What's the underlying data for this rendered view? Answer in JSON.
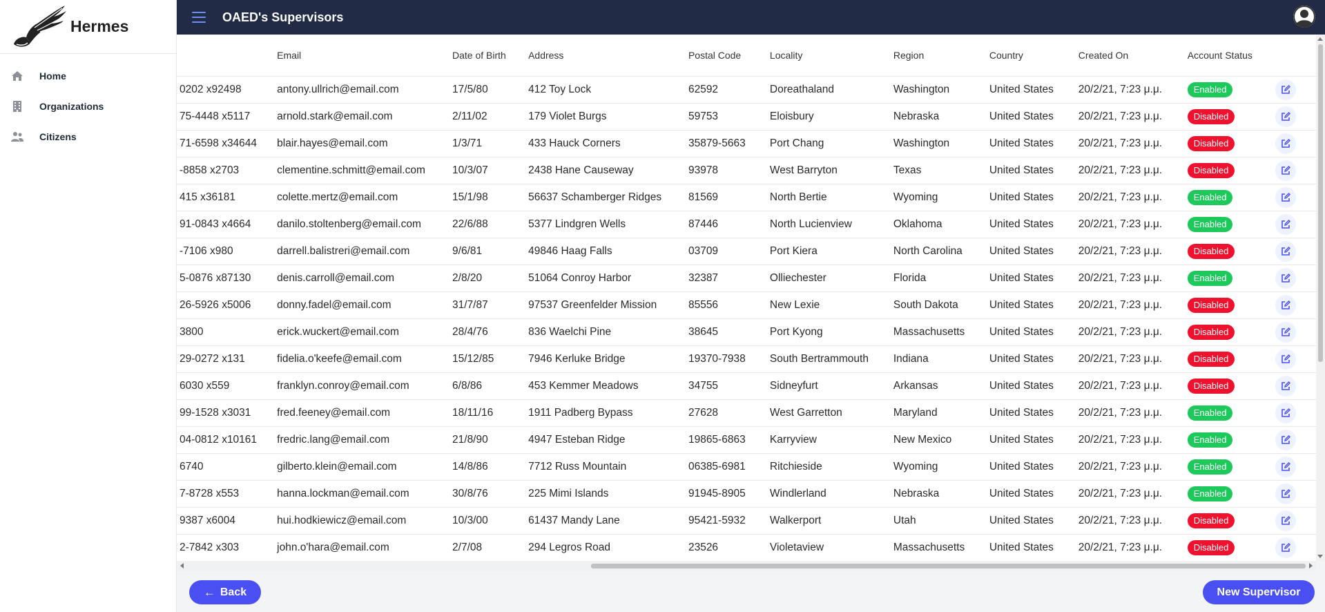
{
  "brand": {
    "name": "Hermes"
  },
  "sidebar": {
    "items": [
      {
        "label": "Home",
        "icon": "home-icon"
      },
      {
        "label": "Organizations",
        "icon": "building-icon"
      },
      {
        "label": "Citizens",
        "icon": "users-icon"
      }
    ]
  },
  "header": {
    "title": "OAED's Supervisors"
  },
  "table": {
    "columns": [
      "",
      "Email",
      "Date of Birth",
      "Address",
      "Postal Code",
      "Locality",
      "Region",
      "Country",
      "Created On",
      "Account Status",
      ""
    ],
    "rows": [
      [
        "0202 x92498",
        "antony.ullrich@email.com",
        "17/5/80",
        "412 Toy Lock",
        "62592",
        "Doreathaland",
        "Washington",
        "United States",
        "20/2/21, 7:23 μ.μ.",
        "Enabled"
      ],
      [
        "75-4448 x5117",
        "arnold.stark@email.com",
        "2/11/02",
        "179 Violet Burgs",
        "59753",
        "Eloisbury",
        "Nebraska",
        "United States",
        "20/2/21, 7:23 μ.μ.",
        "Disabled"
      ],
      [
        "71-6598 x34644",
        "blair.hayes@email.com",
        "1/3/71",
        "433 Hauck Corners",
        "35879-5663",
        "Port Chang",
        "Washington",
        "United States",
        "20/2/21, 7:23 μ.μ.",
        "Disabled"
      ],
      [
        "-8858 x2703",
        "clementine.schmitt@email.com",
        "10/3/07",
        "2438 Hane Causeway",
        "93978",
        "West Barryton",
        "Texas",
        "United States",
        "20/2/21, 7:23 μ.μ.",
        "Disabled"
      ],
      [
        "415 x36181",
        "colette.mertz@email.com",
        "15/1/98",
        "56637 Schamberger Ridges",
        "81569",
        "North Bertie",
        "Wyoming",
        "United States",
        "20/2/21, 7:23 μ.μ.",
        "Enabled"
      ],
      [
        "91-0843 x4664",
        "danilo.stoltenberg@email.com",
        "22/6/88",
        "5377 Lindgren Wells",
        "87446",
        "North Lucienview",
        "Oklahoma",
        "United States",
        "20/2/21, 7:23 μ.μ.",
        "Enabled"
      ],
      [
        "-7106 x980",
        "darrell.balistreri@email.com",
        "9/6/81",
        "49846 Haag Falls",
        "03709",
        "Port Kiera",
        "North Carolina",
        "United States",
        "20/2/21, 7:23 μ.μ.",
        "Disabled"
      ],
      [
        "5-0876 x87130",
        "denis.carroll@email.com",
        "2/8/20",
        "51064 Conroy Harbor",
        "32387",
        "Olliechester",
        "Florida",
        "United States",
        "20/2/21, 7:23 μ.μ.",
        "Enabled"
      ],
      [
        "26-5926 x5006",
        "donny.fadel@email.com",
        "31/7/87",
        "97537 Greenfelder Mission",
        "85556",
        "New Lexie",
        "South Dakota",
        "United States",
        "20/2/21, 7:23 μ.μ.",
        "Disabled"
      ],
      [
        "3800",
        "erick.wuckert@email.com",
        "28/4/76",
        "836 Waelchi Pine",
        "38645",
        "Port Kyong",
        "Massachusetts",
        "United States",
        "20/2/21, 7:23 μ.μ.",
        "Disabled"
      ],
      [
        "29-0272 x131",
        "fidelia.o'keefe@email.com",
        "15/12/85",
        "7946 Kerluke Bridge",
        "19370-7938",
        "South Bertrammouth",
        "Indiana",
        "United States",
        "20/2/21, 7:23 μ.μ.",
        "Disabled"
      ],
      [
        "6030 x559",
        "franklyn.conroy@email.com",
        "6/8/86",
        "453 Kemmer Meadows",
        "34755",
        "Sidneyfurt",
        "Arkansas",
        "United States",
        "20/2/21, 7:23 μ.μ.",
        "Disabled"
      ],
      [
        "99-1528 x3031",
        "fred.feeney@email.com",
        "18/11/16",
        "1911 Padberg Bypass",
        "27628",
        "West Garretton",
        "Maryland",
        "United States",
        "20/2/21, 7:23 μ.μ.",
        "Enabled"
      ],
      [
        "04-0812 x10161",
        "fredric.lang@email.com",
        "21/8/90",
        "4947 Esteban Ridge",
        "19865-6863",
        "Karryview",
        "New Mexico",
        "United States",
        "20/2/21, 7:23 μ.μ.",
        "Enabled"
      ],
      [
        "6740",
        "gilberto.klein@email.com",
        "14/8/86",
        "7712 Russ Mountain",
        "06385-6981",
        "Ritchieside",
        "Wyoming",
        "United States",
        "20/2/21, 7:23 μ.μ.",
        "Enabled"
      ],
      [
        "7-8728 x553",
        "hanna.lockman@email.com",
        "30/8/76",
        "225 Mimi Islands",
        "91945-8905",
        "Windlerland",
        "Nebraska",
        "United States",
        "20/2/21, 7:23 μ.μ.",
        "Enabled"
      ],
      [
        "9387 x6004",
        "hui.hodkiewicz@email.com",
        "10/3/00",
        "61437 Mandy Lane",
        "95421-5932",
        "Walkerport",
        "Utah",
        "United States",
        "20/2/21, 7:23 μ.μ.",
        "Disabled"
      ],
      [
        "2-7842 x303",
        "john.o'hara@email.com",
        "2/7/08",
        "294 Legros Road",
        "23526",
        "Violetaview",
        "Massachusetts",
        "United States",
        "20/2/21, 7:23 μ.μ.",
        "Disabled"
      ]
    ]
  },
  "footer": {
    "back_label": "Back",
    "new_label": "New Supervisor"
  },
  "colors": {
    "header_bg": "#222b45",
    "accent": "#4a4ff2",
    "enabled": "#1ec95b",
    "disabled": "#f0112f"
  }
}
